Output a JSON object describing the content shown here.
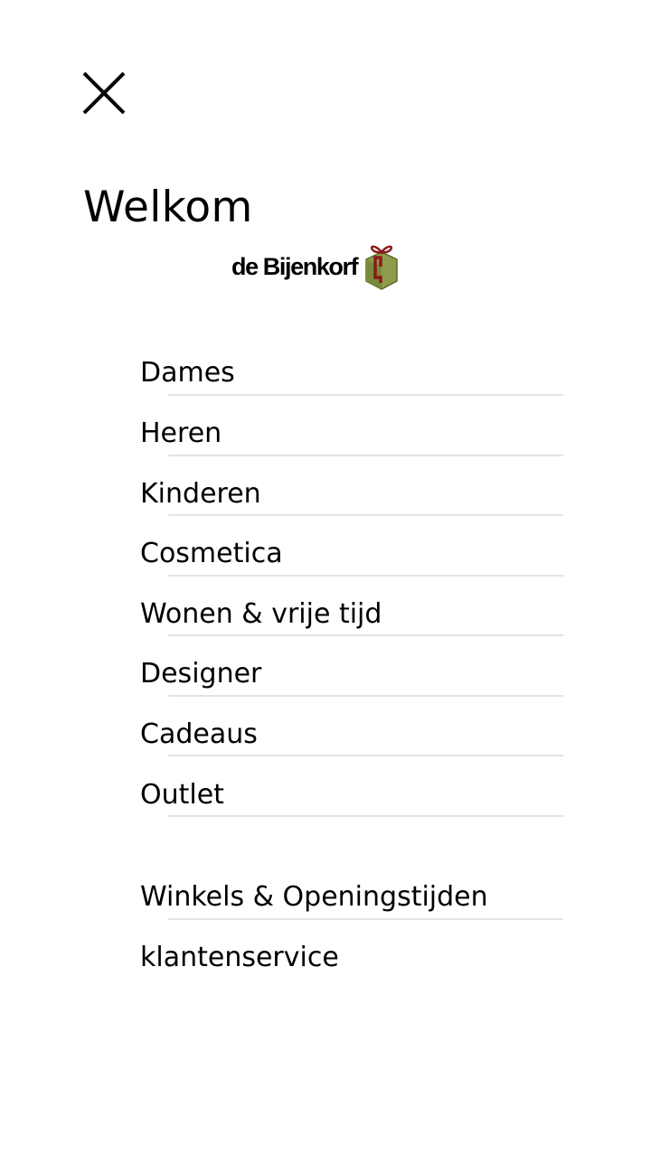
{
  "header": {
    "close_icon": "close-icon",
    "welcome_text": "Welkom"
  },
  "brand": {
    "logo_text": "de Bijenkorf",
    "gift_icon": "gift-box-icon",
    "gift_color": "#8c9c4a",
    "ribbon_color": "#8b1a1a"
  },
  "menu": {
    "categories": [
      {
        "label": "Dames"
      },
      {
        "label": "Heren"
      },
      {
        "label": "Kinderen"
      },
      {
        "label": "Cosmetica"
      },
      {
        "label": "Wonen & vrije tijd"
      },
      {
        "label": "Designer"
      },
      {
        "label": "Cadeaus"
      },
      {
        "label": "Outlet"
      }
    ],
    "service": [
      {
        "label": "Winkels & Openingstijden"
      },
      {
        "label": "klantenservice"
      }
    ]
  }
}
